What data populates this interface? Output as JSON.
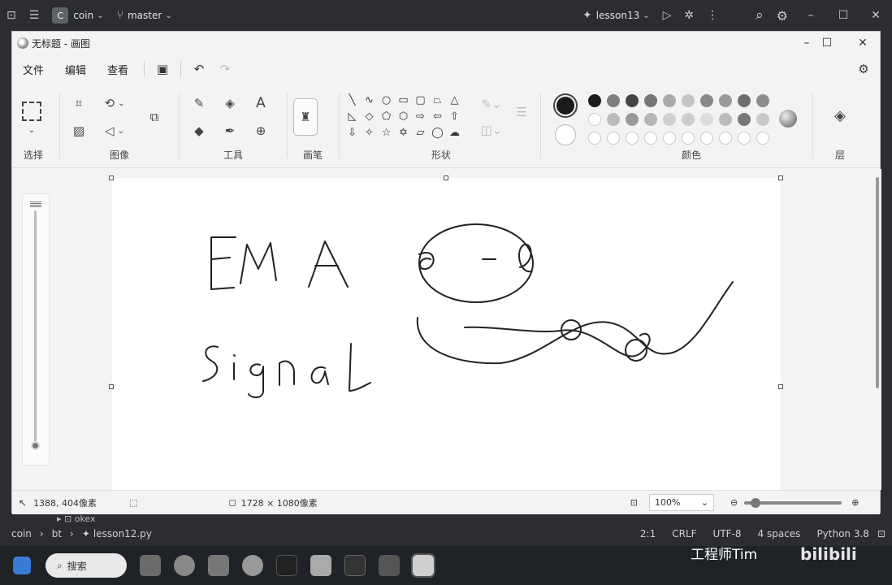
{
  "ide": {
    "project": "coin",
    "branch": "master",
    "run_config": "lesson13",
    "status_path": [
      "coin",
      "bt",
      "lesson12.py"
    ],
    "tree_item": "okex",
    "cursor_pos": "2:1",
    "line_ending": "CRLF",
    "encoding": "UTF-8",
    "indent": "4 spaces",
    "interpreter": "Python 3.8"
  },
  "paint": {
    "window_title": "无标题 - 画图",
    "menus": [
      "文件",
      "编辑",
      "查看"
    ],
    "groups": {
      "select": "选择",
      "image": "图像",
      "tools": "工具",
      "brush": "画笔",
      "shapes": "形状",
      "colors": "颜色",
      "layers": "层"
    },
    "status": {
      "cursor": "1388, 404像素",
      "size": "1728 × 1080像素",
      "zoom": "100%"
    },
    "selected_color": "#1a1a1a"
  },
  "taskbar": {
    "search_label": "搜索"
  },
  "watermark": {
    "text": "工程师Tim",
    "logo": "bilibili"
  },
  "canvas_text": {
    "word1": "EMA",
    "word2": "Signal"
  }
}
